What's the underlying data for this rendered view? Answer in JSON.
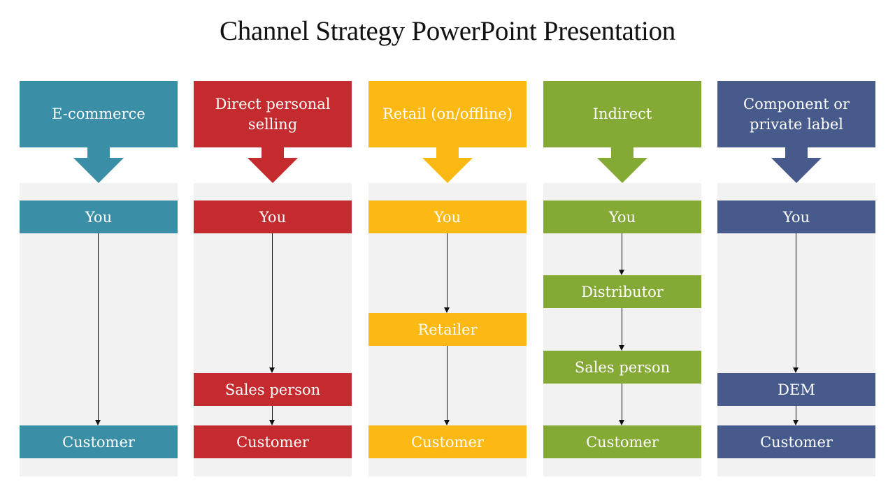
{
  "title": "Channel Strategy PowerPoint Presentation",
  "columns": [
    {
      "header": "E-commerce",
      "color": "#3A8FA6",
      "nodes": [
        "You",
        "Customer"
      ]
    },
    {
      "header": "Direct personal\nselling",
      "color": "#C32B2F",
      "nodes": [
        "You",
        "Sales person",
        "Customer"
      ]
    },
    {
      "header": "Retail (on/offline)",
      "color": "#FDB913",
      "nodes": [
        "You",
        "Retailer",
        "Customer"
      ]
    },
    {
      "header": "Indirect",
      "color": "#85A935",
      "nodes": [
        "You",
        "Distributor",
        "Sales person",
        "Customer"
      ]
    },
    {
      "header": "Component or\nprivate label",
      "color": "#465A8C",
      "nodes": [
        "You",
        "DEM",
        "Customer"
      ]
    }
  ],
  "panel_color": "#F2F2F2",
  "connector_color": "#111111"
}
